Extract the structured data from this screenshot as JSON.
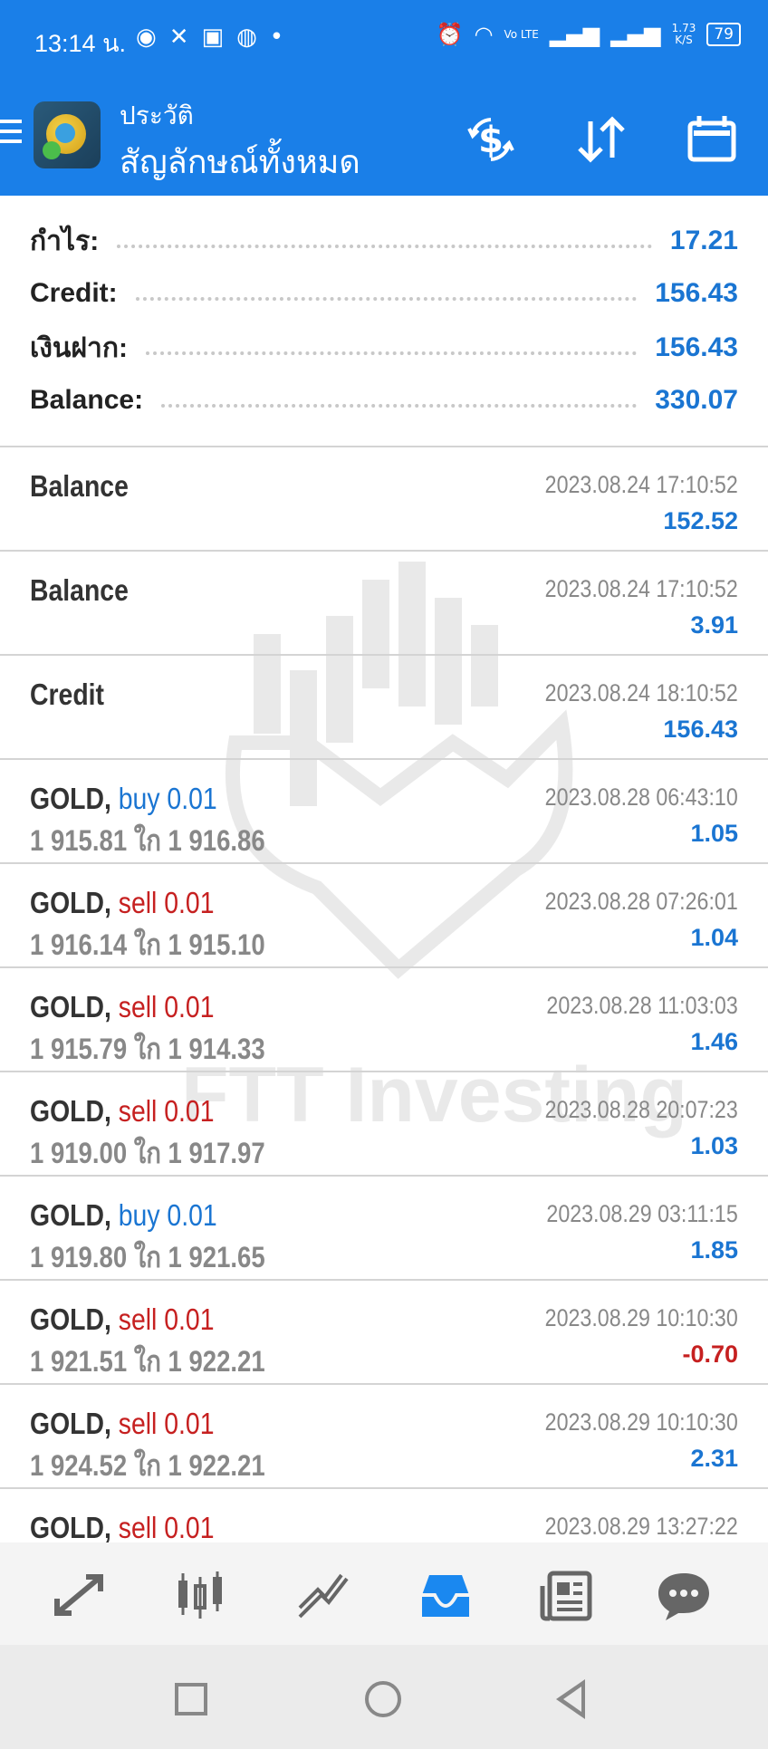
{
  "status_bar": {
    "time": "13:14 น.",
    "icons": [
      "line-icon",
      "x-app-icon",
      "seven-eleven-icon",
      "messenger-icon",
      "dot-icon"
    ],
    "right_icons": [
      "alarm-icon",
      "wifi-icon",
      "volte-icon",
      "signal-icon",
      "signal-icon"
    ],
    "speed_top": "1.73",
    "speed_bottom": "K/S",
    "battery": "79",
    "vo_lte": "Vo LTE"
  },
  "app_bar": {
    "subtitle": "ประวัติ",
    "title": "สัญลักษณ์ทั้งหมด",
    "actions": [
      "currency-exchange-icon",
      "sort-icon",
      "calendar-icon"
    ]
  },
  "summary": {
    "profit": {
      "label": "กำไร:",
      "value": "17.21"
    },
    "credit": {
      "label": "Credit:",
      "value": "156.43"
    },
    "deposit": {
      "label": "เงินฝาก:",
      "value": "156.43"
    },
    "balance": {
      "label": "Balance:",
      "value": "330.07"
    }
  },
  "history": [
    {
      "symbol": "Balance",
      "side": "",
      "volume": "",
      "open": "",
      "close": "",
      "time": "2023.08.24 17:10:52",
      "profit": "152.52"
    },
    {
      "symbol": "Balance",
      "side": "",
      "volume": "",
      "open": "",
      "close": "",
      "time": "2023.08.24 17:10:52",
      "profit": "3.91"
    },
    {
      "symbol": "Credit",
      "side": "",
      "volume": "",
      "open": "",
      "close": "",
      "time": "2023.08.24 18:10:52",
      "profit": "156.43"
    },
    {
      "symbol": "GOLD,",
      "side": "buy",
      "volume": "0.01",
      "open": "1 915.81",
      "close": "1 916.86",
      "time": "2023.08.28 06:43:10",
      "profit": "1.05"
    },
    {
      "symbol": "GOLD,",
      "side": "sell",
      "volume": "0.01",
      "open": "1 916.14",
      "close": "1 915.10",
      "time": "2023.08.28 07:26:01",
      "profit": "1.04"
    },
    {
      "symbol": "GOLD,",
      "side": "sell",
      "volume": "0.01",
      "open": "1 915.79",
      "close": "1 914.33",
      "time": "2023.08.28 11:03:03",
      "profit": "1.46"
    },
    {
      "symbol": "GOLD,",
      "side": "sell",
      "volume": "0.01",
      "open": "1 919.00",
      "close": "1 917.97",
      "time": "2023.08.28 20:07:23",
      "profit": "1.03"
    },
    {
      "symbol": "GOLD,",
      "side": "buy",
      "volume": "0.01",
      "open": "1 919.80",
      "close": "1 921.65",
      "time": "2023.08.29 03:11:15",
      "profit": "1.85"
    },
    {
      "symbol": "GOLD,",
      "side": "sell",
      "volume": "0.01",
      "open": "1 921.51",
      "close": "1 922.21",
      "time": "2023.08.29 10:10:30",
      "profit": "-0.70"
    },
    {
      "symbol": "GOLD,",
      "side": "sell",
      "volume": "0.01",
      "open": "1 924.52",
      "close": "1 922.21",
      "time": "2023.08.29 10:10:30",
      "profit": "2.31"
    },
    {
      "symbol": "GOLD,",
      "side": "sell",
      "volume": "0.01",
      "open": "",
      "close": "",
      "time": "2023.08.29 13:27:22",
      "profit": ""
    }
  ],
  "price_arrow": "ใก",
  "watermark": "FTT Investing",
  "bottom_nav": [
    "trade-icon",
    "chart-icon",
    "analytics-icon",
    "history-icon",
    "news-icon",
    "chat-icon"
  ],
  "colors": {
    "brand": "#1a7fe8",
    "buy": "#1a75d2",
    "sell": "#c62020",
    "profit_pos": "#1a75d2",
    "profit_neg": "#c62020"
  }
}
